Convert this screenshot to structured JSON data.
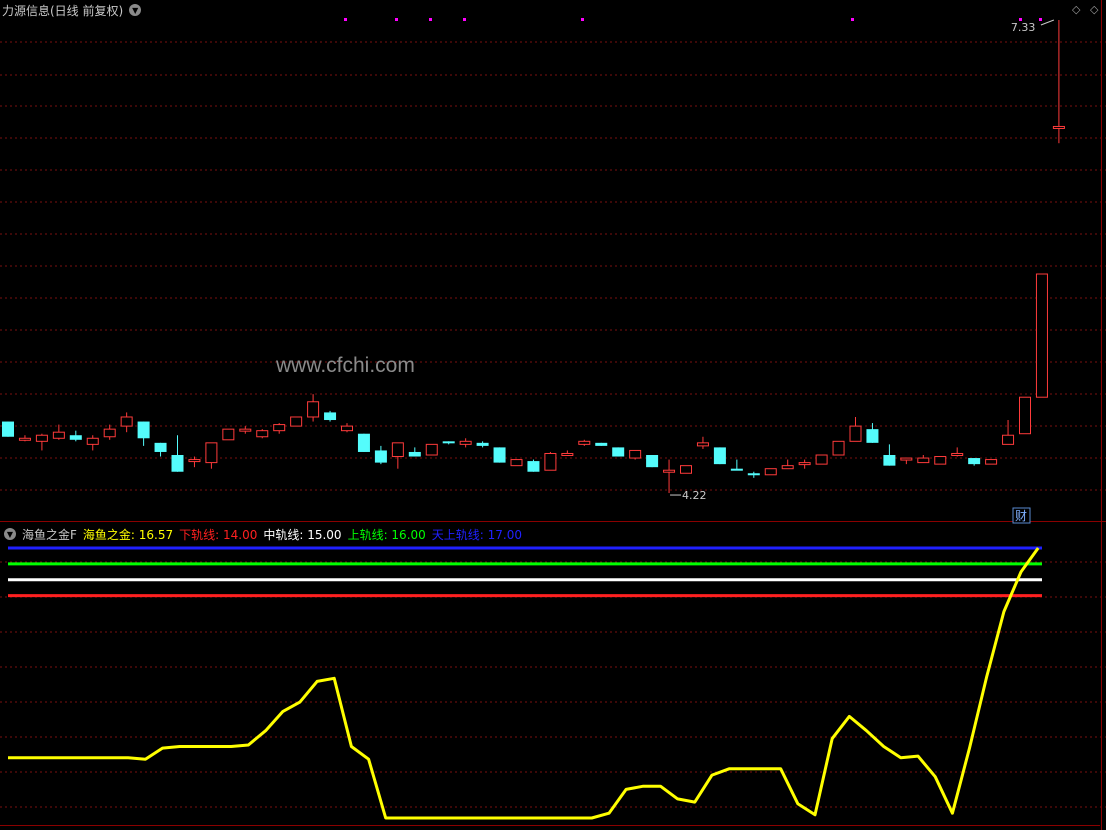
{
  "main_header": {
    "title": "力源信息(日线 前复权)"
  },
  "main_chart": {
    "watermark": "www.cfchi.com",
    "high_label": "7.33",
    "low_label": "4.22",
    "badge": "财",
    "colors": {
      "up": "#ff3b3b",
      "down": "#54fcfc",
      "grid": "#7a1010",
      "divider": "#8a0000",
      "dot": "#ff00ff"
    }
  },
  "indicator_header": {
    "name": "海鱼之金F",
    "items": [
      {
        "label": "海鱼之金: 16.57",
        "color": "#ffff00"
      },
      {
        "label": "下轨线: 14.00",
        "color": "#ff2020"
      },
      {
        "label": "中轨线: 15.00",
        "color": "#ffffff"
      },
      {
        "label": "上轨线: 16.00",
        "color": "#00ff00"
      },
      {
        "label": "天上轨线: 17.00",
        "color": "#2020ff"
      }
    ]
  },
  "chart_data": [
    {
      "type": "candlestick",
      "title": "力源信息(日线 前复权)",
      "fields": [
        "open",
        "high",
        "low",
        "close"
      ],
      "candles": [
        [
          4.69,
          4.69,
          4.59,
          4.59
        ],
        [
          4.58,
          4.6,
          4.56,
          4.58
        ],
        [
          4.56,
          4.61,
          4.5,
          4.6
        ],
        [
          4.58,
          4.67,
          4.57,
          4.62
        ],
        [
          4.6,
          4.63,
          4.56,
          4.57
        ],
        [
          4.54,
          4.6,
          4.5,
          4.58
        ],
        [
          4.59,
          4.67,
          4.57,
          4.64
        ],
        [
          4.66,
          4.75,
          4.62,
          4.72
        ],
        [
          4.69,
          4.69,
          4.53,
          4.58
        ],
        [
          4.55,
          4.55,
          4.46,
          4.49
        ],
        [
          4.47,
          4.6,
          4.36,
          4.36
        ],
        [
          4.44,
          4.46,
          4.39,
          4.44
        ],
        [
          4.42,
          4.55,
          4.38,
          4.55
        ],
        [
          4.57,
          4.64,
          4.57,
          4.64
        ],
        [
          4.64,
          4.66,
          4.61,
          4.64
        ],
        [
          4.59,
          4.64,
          4.58,
          4.63
        ],
        [
          4.63,
          4.68,
          4.61,
          4.67
        ],
        [
          4.66,
          4.72,
          4.66,
          4.72
        ],
        [
          4.72,
          4.87,
          4.69,
          4.82
        ],
        [
          4.75,
          4.76,
          4.69,
          4.7
        ],
        [
          4.63,
          4.68,
          4.62,
          4.66
        ],
        [
          4.61,
          4.61,
          4.49,
          4.49
        ],
        [
          4.5,
          4.53,
          4.41,
          4.42
        ],
        [
          4.46,
          4.55,
          4.38,
          4.55
        ],
        [
          4.49,
          4.52,
          4.46,
          4.46
        ],
        [
          4.47,
          4.54,
          4.47,
          4.54
        ],
        [
          4.56,
          4.56,
          4.54,
          4.55
        ],
        [
          4.54,
          4.58,
          4.52,
          4.56
        ],
        [
          4.55,
          4.56,
          4.52,
          4.53
        ],
        [
          4.52,
          4.52,
          4.42,
          4.42
        ],
        [
          4.4,
          4.44,
          4.4,
          4.44
        ],
        [
          4.43,
          4.44,
          4.36,
          4.36
        ],
        [
          4.37,
          4.49,
          4.37,
          4.48
        ],
        [
          4.48,
          4.5,
          4.48,
          4.48
        ],
        [
          4.54,
          4.57,
          4.53,
          4.56
        ],
        [
          4.55,
          4.55,
          4.53,
          4.53
        ],
        [
          4.52,
          4.52,
          4.46,
          4.46
        ],
        [
          4.45,
          4.5,
          4.44,
          4.5
        ],
        [
          4.47,
          4.47,
          4.39,
          4.39
        ],
        [
          4.37,
          4.44,
          4.22,
          4.37
        ],
        [
          4.35,
          4.4,
          4.35,
          4.4
        ],
        [
          4.53,
          4.59,
          4.51,
          4.55
        ],
        [
          4.52,
          4.52,
          4.41,
          4.41
        ],
        [
          4.38,
          4.44,
          4.37,
          4.37
        ],
        [
          4.35,
          4.36,
          4.32,
          4.34
        ],
        [
          4.34,
          4.38,
          4.34,
          4.38
        ],
        [
          4.38,
          4.44,
          4.38,
          4.4
        ],
        [
          4.42,
          4.44,
          4.38,
          4.42
        ],
        [
          4.41,
          4.47,
          4.41,
          4.47
        ],
        [
          4.47,
          4.56,
          4.47,
          4.56
        ],
        [
          4.56,
          4.72,
          4.56,
          4.66
        ],
        [
          4.64,
          4.68,
          4.55,
          4.55
        ],
        [
          4.47,
          4.54,
          4.4,
          4.4
        ],
        [
          4.45,
          4.45,
          4.41,
          4.45
        ],
        [
          4.42,
          4.47,
          4.42,
          4.45
        ],
        [
          4.41,
          4.46,
          4.41,
          4.46
        ],
        [
          4.47,
          4.52,
          4.46,
          4.48
        ],
        [
          4.45,
          4.45,
          4.4,
          4.41
        ],
        [
          4.41,
          4.44,
          4.41,
          4.44
        ],
        [
          4.54,
          4.7,
          4.54,
          4.6
        ],
        [
          4.61,
          4.8,
          4.61,
          4.85
        ],
        [
          4.85,
          5.66,
          4.85,
          5.66
        ],
        [
          6.63,
          7.33,
          6.52,
          6.63
        ]
      ]
    },
    {
      "type": "line",
      "title": "海鱼之金F",
      "x_count": 63,
      "series": [
        {
          "name": "海鱼之金",
          "color": "#ffff00",
          "values": [
            3.8,
            3.8,
            3.8,
            3.8,
            3.8,
            3.8,
            3.8,
            3.8,
            3.7,
            4.4,
            4.5,
            4.5,
            4.5,
            4.5,
            4.6,
            5.5,
            6.7,
            7.3,
            8.6,
            8.8,
            4.5,
            3.7,
            0,
            0,
            0,
            0,
            0,
            0,
            0,
            0,
            0,
            0,
            0,
            0,
            0,
            0.3,
            1.8,
            2,
            2,
            1.2,
            1,
            2.7,
            3.1,
            3.1,
            3.1,
            3.1,
            0.9,
            0.2,
            5,
            6.4,
            5.5,
            4.5,
            3.8,
            3.9,
            2.6,
            0.3,
            4.4,
            8.9,
            13,
            15.5,
            17
          ]
        },
        {
          "name": "下轨线",
          "color": "#ff2020",
          "values": [
            14
          ]
        },
        {
          "name": "中轨线",
          "color": "#ffffff",
          "values": [
            15
          ]
        },
        {
          "name": "上轨线",
          "color": "#00ff00",
          "values": [
            16
          ]
        },
        {
          "name": "天上轨线",
          "color": "#2020ff",
          "values": [
            17
          ]
        }
      ]
    }
  ]
}
